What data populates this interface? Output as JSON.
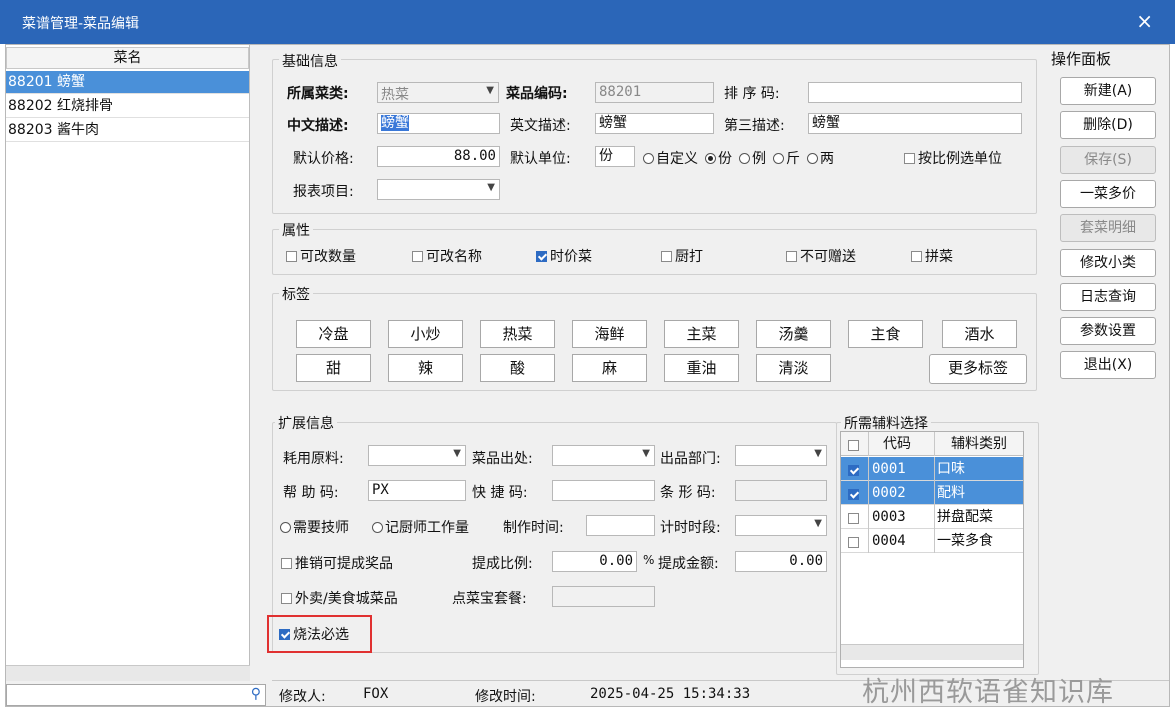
{
  "window": {
    "title": "菜谱管理-菜品编辑",
    "close": "×"
  },
  "list": {
    "header": "菜名",
    "items": [
      {
        "label": "88201 螃蟹",
        "selected": true
      },
      {
        "label": "88202 红烧排骨",
        "selected": false
      },
      {
        "label": "88203 酱牛肉",
        "selected": false
      }
    ],
    "search_value": ""
  },
  "basic": {
    "title": "基础信息",
    "category_label": "所属菜类:",
    "category_value": "热菜",
    "code_label": "菜品编码:",
    "code_value": "88201",
    "sort_label": "排 序 码:",
    "sort_value": "",
    "cn_label": "中文描述:",
    "cn_value": "螃蟹",
    "en_label": "英文描述:",
    "en_value": "螃蟹",
    "third_label": "第三描述:",
    "third_value": "螃蟹",
    "price_label": "默认价格:",
    "price_value": "88.00",
    "unit_label": "默认单位:",
    "unit_value": "份",
    "unit_options": [
      {
        "label": "自定义",
        "checked": false
      },
      {
        "label": "份",
        "checked": true
      },
      {
        "label": "例",
        "checked": false
      },
      {
        "label": "斤",
        "checked": false
      },
      {
        "label": "两",
        "checked": false
      }
    ],
    "ratio_unit_label": "按比例选单位",
    "report_label": "报表项目:",
    "report_value": ""
  },
  "attrs": {
    "title": "属性",
    "items": [
      {
        "label": "可改数量",
        "checked": false
      },
      {
        "label": "可改名称",
        "checked": false
      },
      {
        "label": "时价菜",
        "checked": true
      },
      {
        "label": "厨打",
        "checked": false
      },
      {
        "label": "不可赠送",
        "checked": false
      },
      {
        "label": "拼菜",
        "checked": false
      }
    ]
  },
  "tags": {
    "title": "标签",
    "row1": [
      "冷盘",
      "小炒",
      "热菜",
      "海鲜",
      "主菜",
      "汤羹",
      "主食",
      "酒水"
    ],
    "row2": [
      "甜",
      "辣",
      "酸",
      "麻",
      "重油",
      "清淡"
    ],
    "more": "更多标签"
  },
  "ext": {
    "title": "扩展信息",
    "material_label": "耗用原料:",
    "origin_label": "菜品出处:",
    "dept_label": "出品部门:",
    "help_label": "帮 助 码:",
    "help_value": "PX",
    "quick_label": "快 捷 码:",
    "quick_value": "",
    "barcode_label": "条 形 码:",
    "barcode_value": "",
    "need_chef": "需要技师",
    "record_chef": "记厨师工作量",
    "make_time_label": "制作时间:",
    "timer_label": "计时时段:",
    "promo_label": "推销可提成奖品",
    "promo_checked": false,
    "ratio_label": "提成比例:",
    "ratio_value": "0.00",
    "pct": "%",
    "amount_label": "提成金额:",
    "amount_value": "0.00",
    "takeout_label": "外卖/美食城菜品",
    "takeout_checked": false,
    "combo_label": "点菜宝套餐:",
    "cook_required_label": "烧法必选",
    "cook_required_checked": true
  },
  "aux": {
    "title": "所需辅料选择",
    "col_code": "代码",
    "col_type": "辅料类别",
    "rows": [
      {
        "code": "0001",
        "type": "口味",
        "checked": true
      },
      {
        "code": "0002",
        "type": "配料",
        "checked": true
      },
      {
        "code": "0003",
        "type": "拼盘配菜",
        "checked": false
      },
      {
        "code": "0004",
        "type": "一菜多食",
        "checked": false
      }
    ]
  },
  "ops": {
    "title": "操作面板",
    "buttons": [
      {
        "label": "新建(A)",
        "enabled": true
      },
      {
        "label": "删除(D)",
        "enabled": true
      },
      {
        "label": "保存(S)",
        "enabled": false
      },
      {
        "label": "一菜多价",
        "enabled": true
      },
      {
        "label": "套菜明细",
        "enabled": false
      },
      {
        "label": "修改小类",
        "enabled": true
      },
      {
        "label": "日志查询",
        "enabled": true
      },
      {
        "label": "参数设置",
        "enabled": true
      },
      {
        "label": "退出(X)",
        "enabled": true
      }
    ]
  },
  "status": {
    "modifier_label": "修改人:",
    "modifier_value": "FOX",
    "time_label": "修改时间:",
    "time_value": "2025-04-25 15:34:33"
  },
  "watermark": "杭州西软语雀知识库"
}
